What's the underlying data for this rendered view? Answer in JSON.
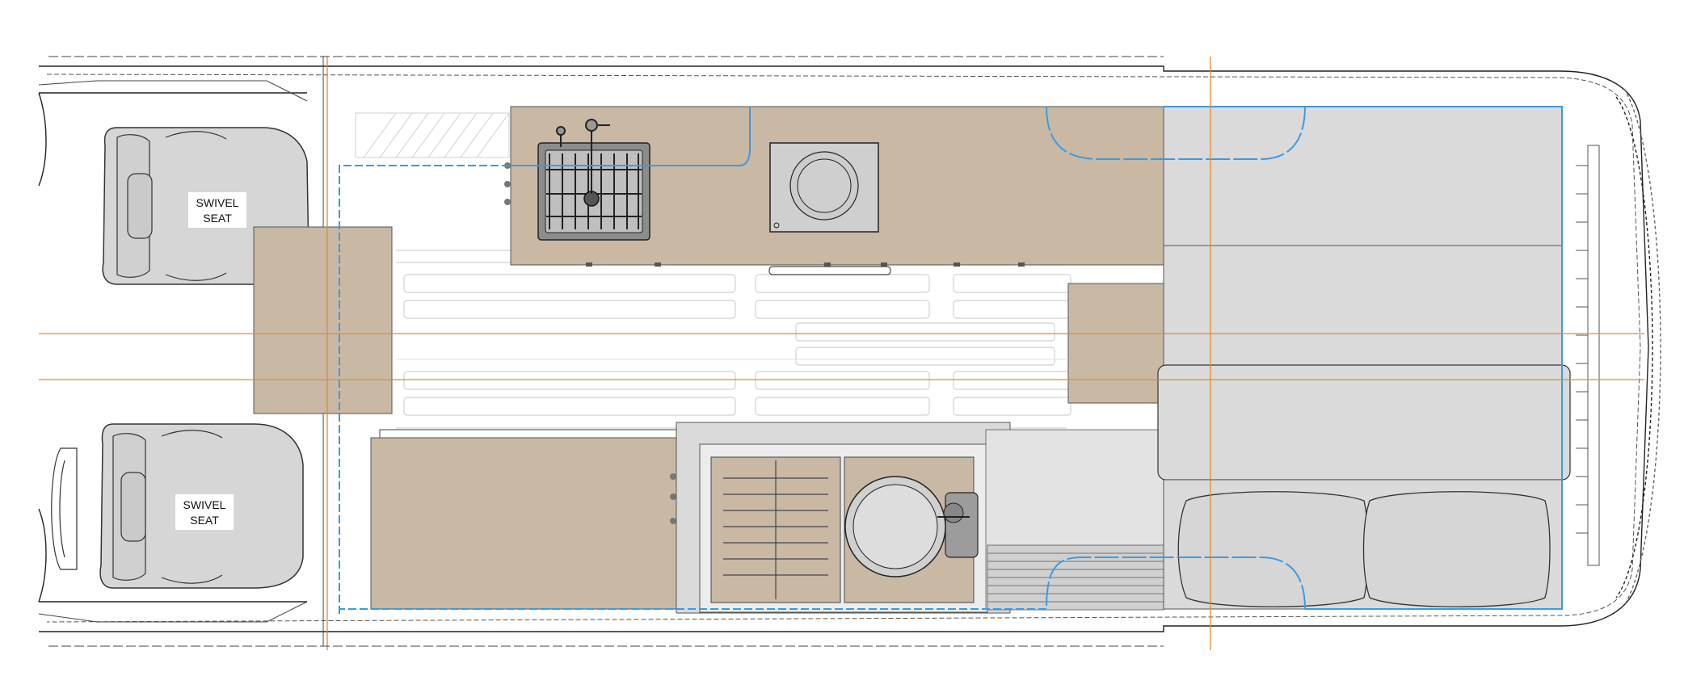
{
  "labels": {
    "seat_left_top_line1": "SWIVEL",
    "seat_left_top_line2": "SEAT",
    "seat_left_bottom_line1": "SWIVEL",
    "seat_left_bottom_line2": "SEAT"
  },
  "colors": {
    "cabinet": "#c8b8a4",
    "bed": "#dadada",
    "seat": "#d6d6d6",
    "outline": "#333333",
    "centerline": "#e38a2e",
    "water_line": "#3b9be3",
    "hatch": "#cfcfcf"
  },
  "icons": {
    "sink": "sink-icon",
    "faucet": "faucet-icon",
    "stove": "induction-cooktop-icon",
    "toilet": "toilet-icon"
  }
}
